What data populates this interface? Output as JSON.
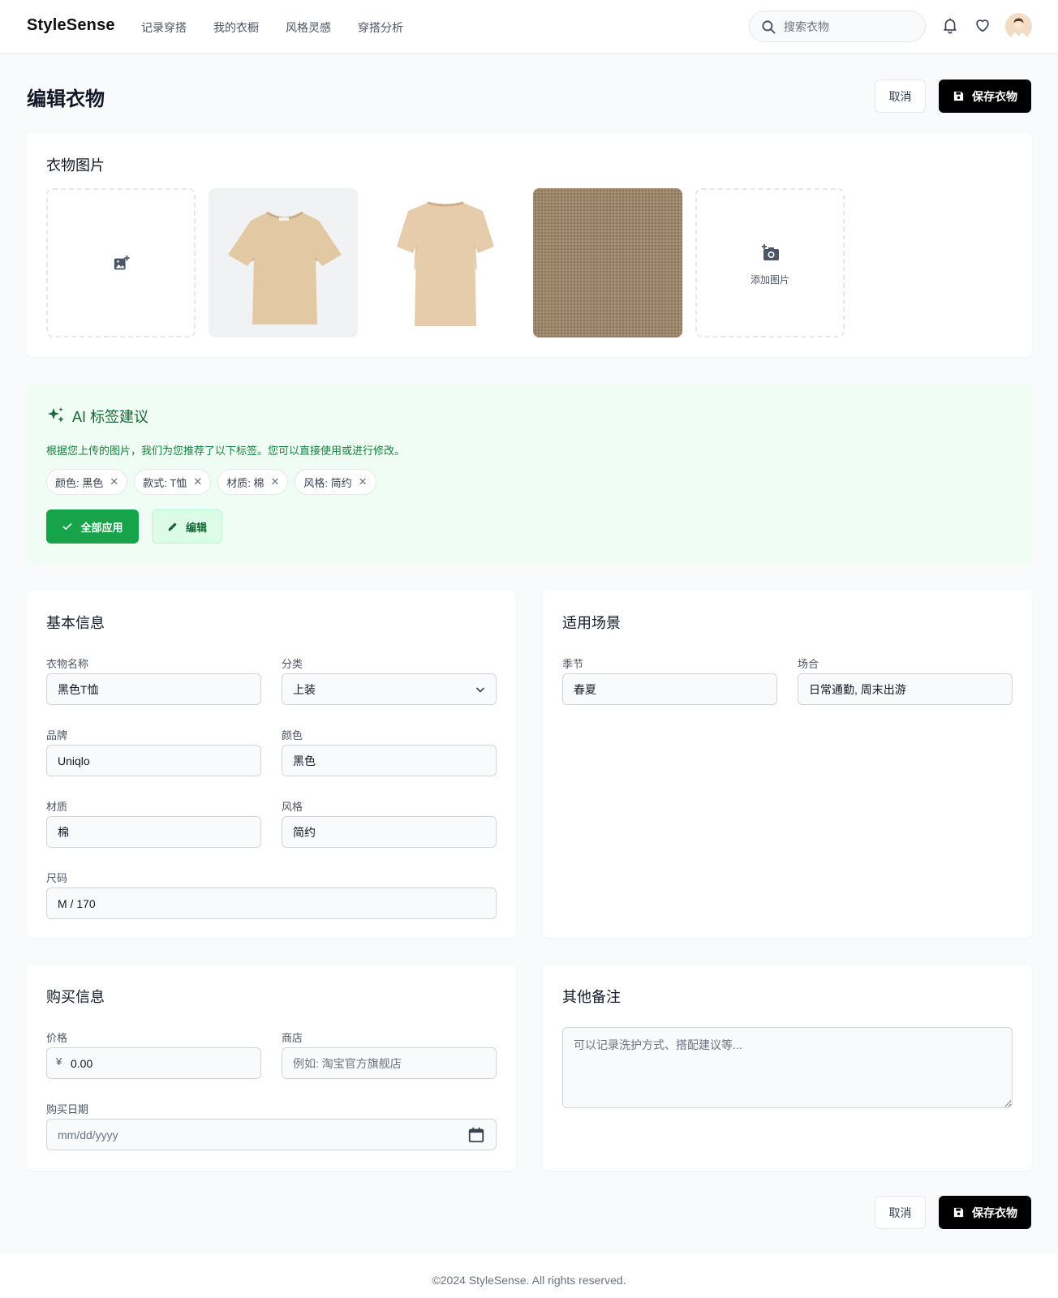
{
  "header": {
    "brand": "StyleSense",
    "nav": [
      "记录穿搭",
      "我的衣橱",
      "风格灵感",
      "穿搭分析"
    ],
    "search_placeholder": "搜索衣物"
  },
  "page": {
    "title": "编辑衣物",
    "cancel_label": "取消",
    "save_label": "保存衣物"
  },
  "images": {
    "title": "衣物图片",
    "add_label": "添加图片"
  },
  "ai": {
    "title": "AI 标签建议",
    "description": "根据您上传的图片，我们为您推荐了以下标签。您可以直接使用或进行修改。",
    "tags": [
      "颜色: 黑色",
      "款式: T恤",
      "材质: 棉",
      "风格: 简约"
    ],
    "apply_label": "全部应用",
    "edit_label": "编辑"
  },
  "basic": {
    "title": "基本信息",
    "name_label": "衣物名称",
    "name_value": "黑色T恤",
    "category_label": "分类",
    "category_value": "上装",
    "brand_label": "品牌",
    "brand_value": "Uniqlo",
    "color_label": "颜色",
    "color_value": "黑色",
    "material_label": "材质",
    "material_value": "棉",
    "style_label": "风格",
    "style_value": "简约",
    "size_label": "尺码",
    "size_value": "M / 170"
  },
  "scene": {
    "title": "适用场景",
    "season_label": "季节",
    "season_value": "春夏",
    "occasion_label": "场合",
    "occasion_value": "日常通勤, 周末出游"
  },
  "purchase": {
    "title": "购买信息",
    "price_label": "价格",
    "currency": "¥",
    "price_value": "0.00",
    "store_label": "商店",
    "store_placeholder": "例如: 淘宝官方旗舰店",
    "date_label": "购买日期",
    "date_placeholder": "mm/dd/yyyy"
  },
  "notes": {
    "title": "其他备注",
    "placeholder": "可以记录洗护方式、搭配建议等..."
  },
  "footer": "©2024 StyleSense. All rights reserved.",
  "colors": {
    "primary": "#000000",
    "accent_green": "#16a34a",
    "ai_bg": "#f0fdf4",
    "shirt": "#e2c9a4",
    "fabric": "#9b8669"
  }
}
